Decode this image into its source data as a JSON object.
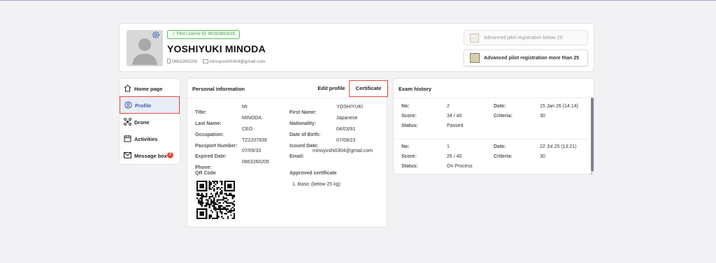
{
  "profile": {
    "license_badge": "Pilot License ID: 8029289/2025",
    "name": "YOSHIYUKI MINODA",
    "phone": "0863260209",
    "email": "minoyoshi0304@gmail.com"
  },
  "registration": {
    "below25": "Advanced pilot registration below 25",
    "above25": "Advanced pilot registration more than 25"
  },
  "sidebar": {
    "items": [
      {
        "label": "Home page"
      },
      {
        "label": "Profile"
      },
      {
        "label": "Drone"
      },
      {
        "label": "Activities"
      },
      {
        "label": "Message box",
        "badge": "7"
      }
    ]
  },
  "personal": {
    "title": "Personal information",
    "edit_label": "Edit profile",
    "certificate_label": "Certificate",
    "left": [
      {
        "label": "Title:",
        "value": "Mr"
      },
      {
        "label": "Last Name:",
        "value": "MINODA"
      },
      {
        "label": "Occupation:",
        "value": "CEO"
      },
      {
        "label": "Passport Number:",
        "value": "TZ2207839"
      },
      {
        "label": "Expired Date:",
        "value": "07/09/33"
      },
      {
        "label": "Phone:",
        "value": "0863260209"
      }
    ],
    "right": [
      {
        "label": "First Name:",
        "value": "YOSHIYUKI"
      },
      {
        "label": "Nationality:",
        "value": "Japanese"
      },
      {
        "label": "Date of Birth:",
        "value": "04/03/91"
      },
      {
        "label": "Issued Date:",
        "value": "07/09/23"
      },
      {
        "label": "Email:",
        "value": "minoyoshi0304@gmail.com"
      }
    ],
    "qr_label": "QR Code",
    "approved_label": "Approved certificate",
    "approved_item": "1. Basic (below 25 kg)"
  },
  "exam": {
    "title": "Exam history",
    "entries": [
      {
        "no_label": "No:",
        "no": "2",
        "score_label": "Score:",
        "score": "34 / 40",
        "status_label": "Status:",
        "status": "Passed",
        "date_label": "Date:",
        "date": "15 Jan 26 (14:14)",
        "criteria_label": "Criteria:",
        "criteria": "30"
      },
      {
        "no_label": "No:",
        "no": "1",
        "score_label": "Score:",
        "score": "26 / 40",
        "status_label": "Status:",
        "status": "On Process",
        "date_label": "Date:",
        "date": "22 Jul 25 (13:21)",
        "criteria_label": "Criteria:",
        "criteria": "30"
      }
    ]
  },
  "colors": {
    "accent_red": "#e74c3c",
    "badge_green": "#5cb85c",
    "active_bg": "#e7ecf7"
  }
}
